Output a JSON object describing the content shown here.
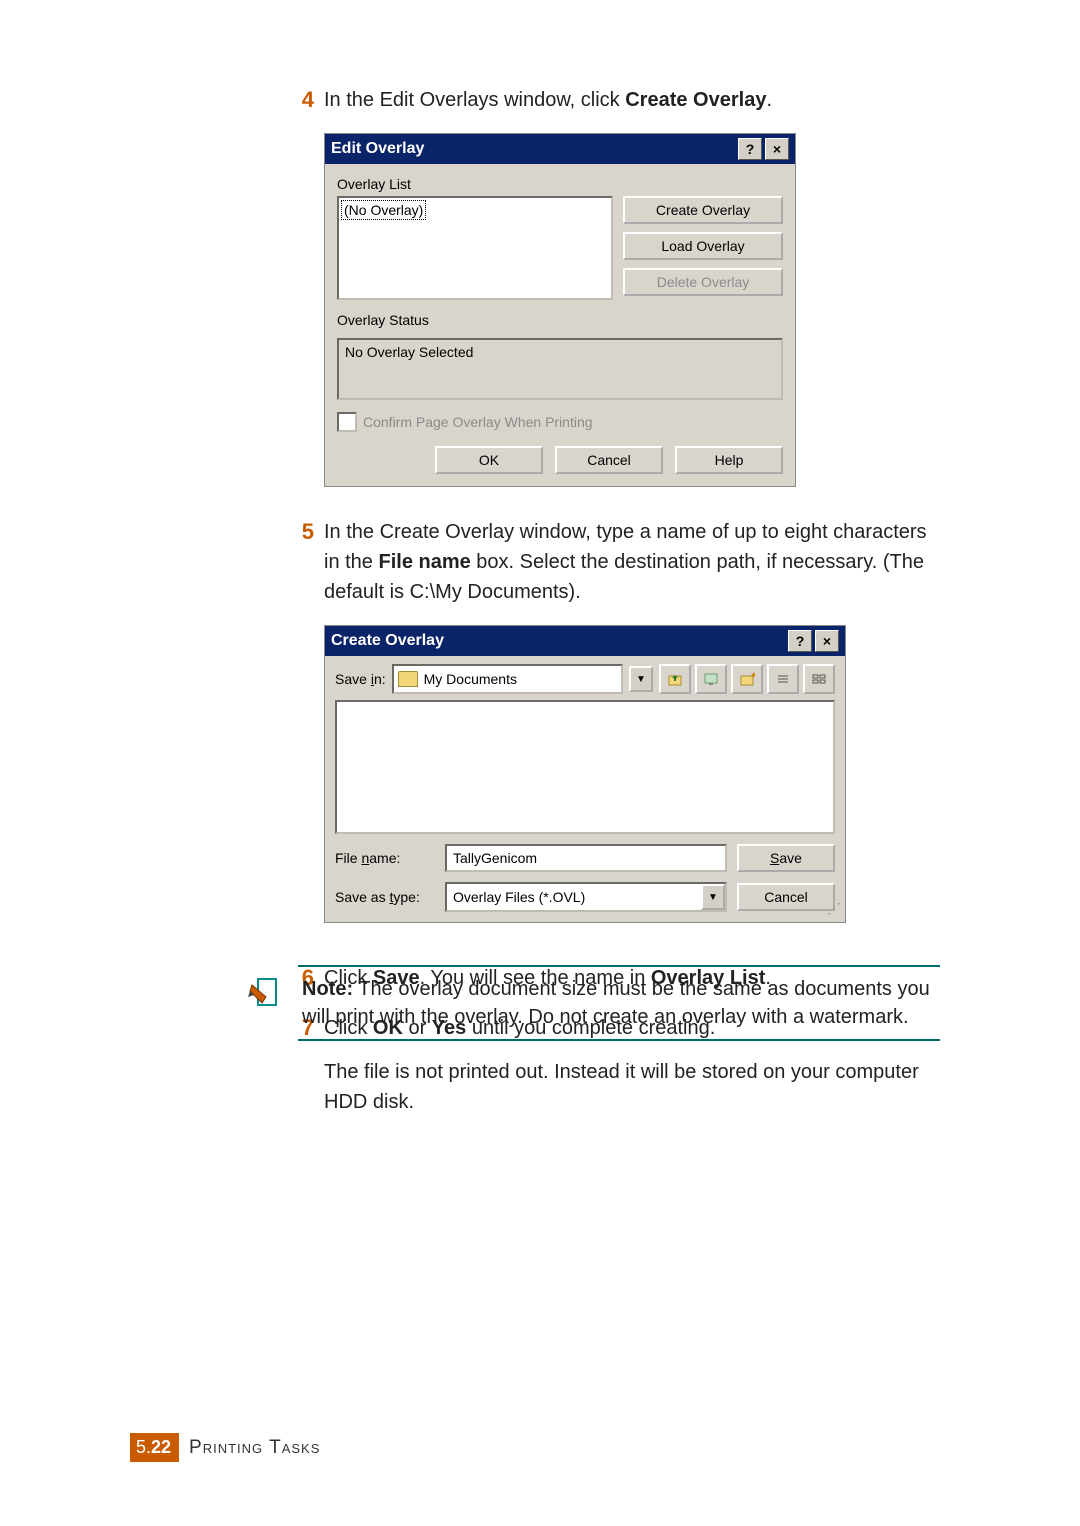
{
  "steps": {
    "s4": {
      "num": "4",
      "pre": "In the Edit Overlays window, click ",
      "bold": "Create Overlay",
      "post": "."
    },
    "s5": {
      "num": "5",
      "pre": "In the Create Overlay window, type a name of up to eight characters in the ",
      "bold": "File name",
      "post": " box. Select the destination path, if necessary. (The default is C:\\My Documents)."
    },
    "s6": {
      "num": "6",
      "pre1": "Click ",
      "bold1": "Save",
      "mid": ". You will see the name in ",
      "bold2": "Overlay List",
      "post": "."
    },
    "s7": {
      "num": "7",
      "pre": "Click ",
      "bold1": "OK",
      "mid": " or ",
      "bold2": "Yes",
      "post": " until you complete creating."
    },
    "s7extra": "The file is not printed out. Instead it will be stored on your computer HDD disk."
  },
  "edit_overlay": {
    "title": "Edit Overlay",
    "help_btn": "?",
    "close_btn": "×",
    "overlay_list_label": "Overlay List",
    "selected_item": "(No Overlay)",
    "buttons": {
      "create": "Create Overlay",
      "load": "Load Overlay",
      "delete": "Delete Overlay"
    },
    "status_label": "Overlay Status",
    "status_text": "No Overlay Selected",
    "confirm_label": "Confirm Page Overlay When Printing",
    "ok": "OK",
    "cancel": "Cancel",
    "help": "Help"
  },
  "create_overlay": {
    "title": "Create Overlay",
    "help_btn": "?",
    "close_btn": "×",
    "save_in_label": "Save in:",
    "save_in_value": "My Documents",
    "file_name_label": "File name:",
    "file_name_value": "TallyGenicom",
    "save_as_type_label": "Save as type:",
    "save_as_type_value": "Overlay Files (*.OVL)",
    "save_btn": "Save",
    "cancel_btn": "Cancel"
  },
  "note": {
    "label": "Note:",
    "text": " The overlay document size must be the same as documents you will print with the overlay. Do not create an overlay with a watermark."
  },
  "footer": {
    "chapter": "5.",
    "page": "22",
    "section": "Printing Tasks"
  }
}
